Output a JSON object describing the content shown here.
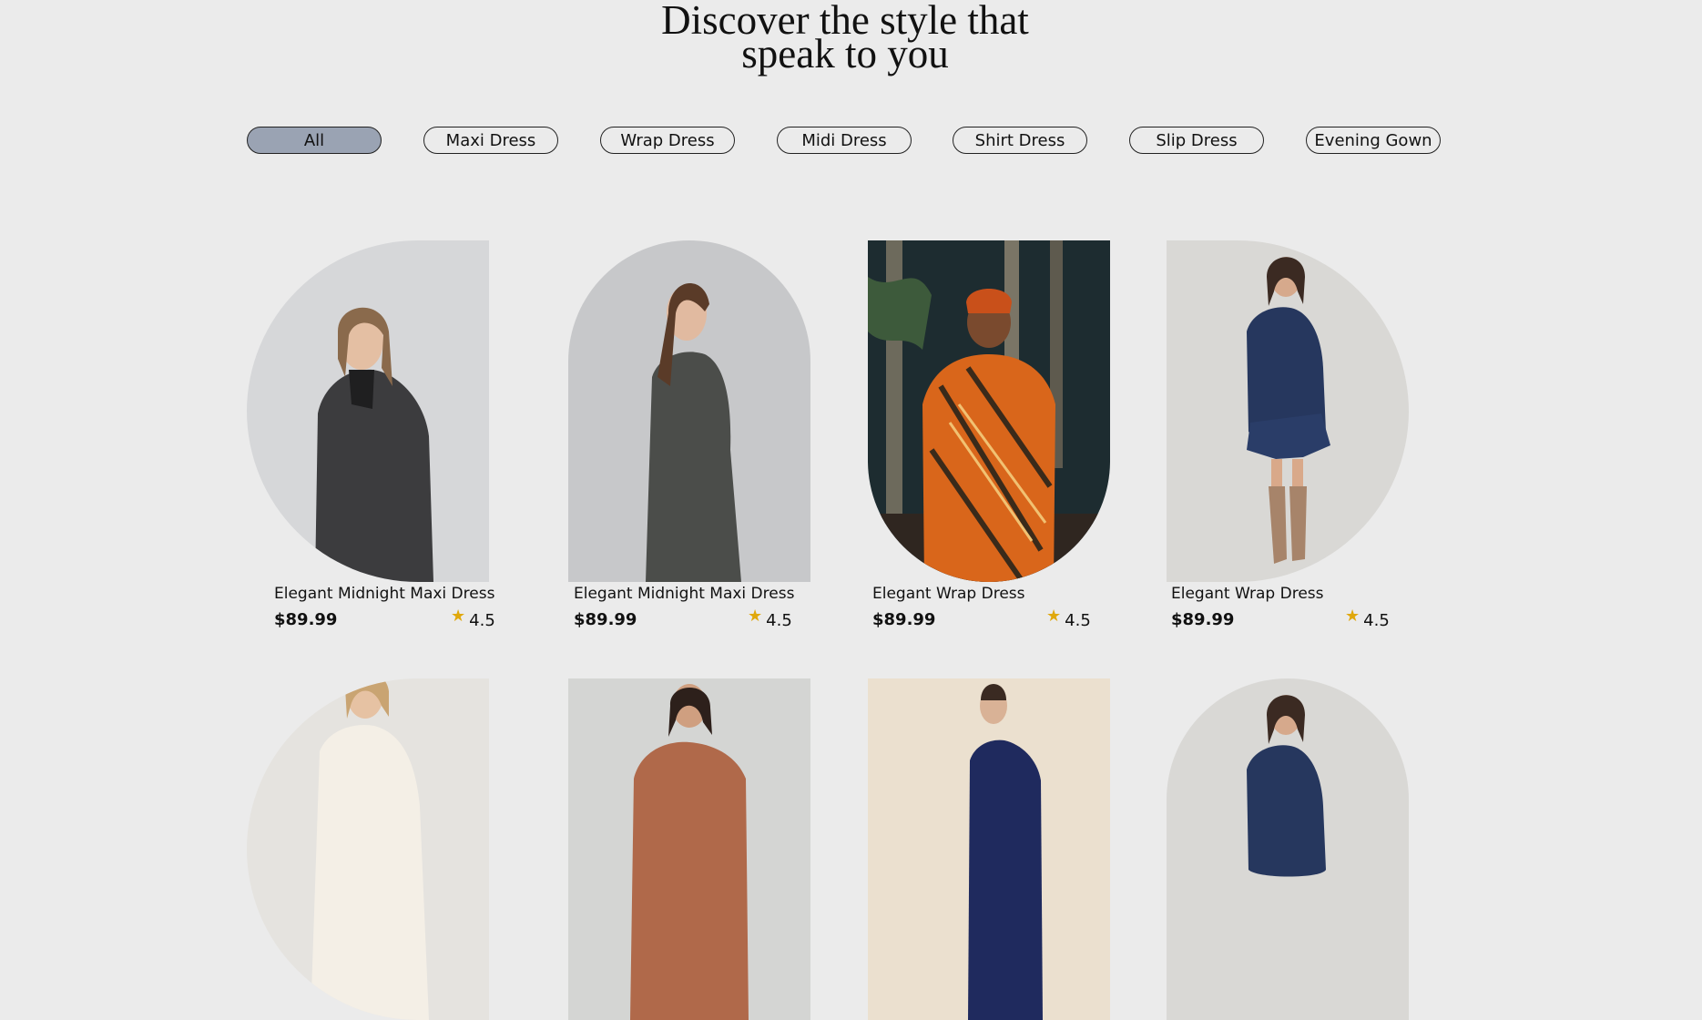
{
  "hero": {
    "title_line1": "Discover the style that",
    "title_line2": "speak to you"
  },
  "filters": [
    "All",
    "Maxi Dress",
    "Wrap Dress",
    "Midi Dress",
    "Shirt Dress",
    "Slip Dress",
    "Evening Gown"
  ],
  "active_filter": "All",
  "products_row1": [
    {
      "name": "Elegant Midnight Maxi Dress",
      "price": "$89.99",
      "rating": "4.5"
    },
    {
      "name": "Elegant Midnight Maxi Dress",
      "price": "$89.99",
      "rating": "4.5"
    },
    {
      "name": "Elegant Wrap Dress",
      "price": "$89.99",
      "rating": "4.5"
    },
    {
      "name": "Elegant Wrap Dress",
      "price": "$89.99",
      "rating": "4.5"
    }
  ],
  "colors": {
    "page_bg": "#ebebeb",
    "active_chip": "#9aa3b3",
    "star": "#e0a80c"
  },
  "icons": {
    "rating": "star-icon"
  }
}
